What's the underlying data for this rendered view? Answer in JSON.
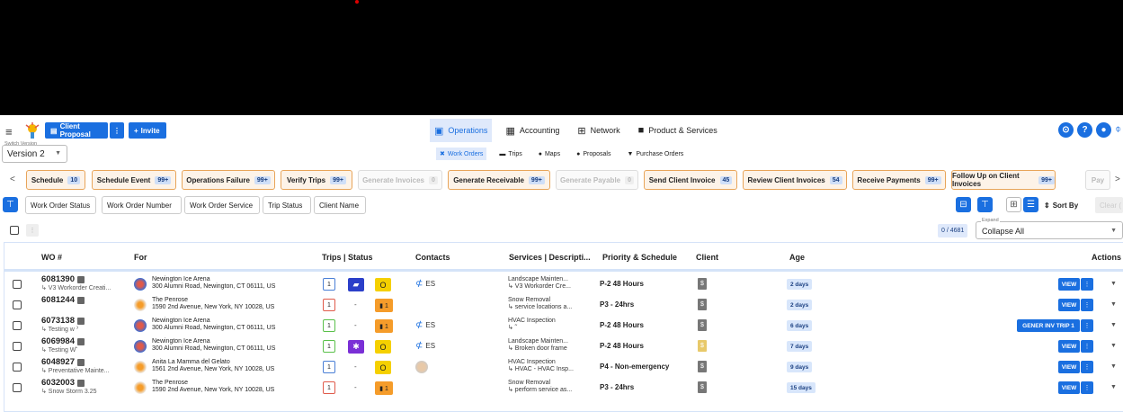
{
  "topbar": {
    "client_proposal": "Client Proposal",
    "more": "⋮",
    "invite": "Invite",
    "nav": [
      {
        "label": "Operations",
        "icon": "operations-icon",
        "glyph": "▣",
        "active": true
      },
      {
        "label": "Accounting",
        "icon": "accounting-icon",
        "glyph": "▦",
        "active": false
      },
      {
        "label": "Network",
        "icon": "network-icon",
        "glyph": "⊞",
        "active": false
      },
      {
        "label": "Product & Services",
        "icon": "briefcase-icon",
        "glyph": "■",
        "active": false
      }
    ]
  },
  "version": {
    "label": "Switch Version",
    "value": "Version 2"
  },
  "subnav": [
    {
      "label": "Work Orders",
      "icon": "work-orders-icon",
      "glyph": "✖",
      "active": true
    },
    {
      "label": "Trips",
      "icon": "car-icon",
      "glyph": "▬",
      "active": false
    },
    {
      "label": "Maps",
      "icon": "map-pin-icon",
      "glyph": "●",
      "active": false
    },
    {
      "label": "Proposals",
      "icon": "proposal-icon",
      "glyph": "●",
      "active": false
    },
    {
      "label": "Purchase Orders",
      "icon": "cart-icon",
      "glyph": "▼",
      "active": false
    }
  ],
  "chips": [
    {
      "label": "Schedule",
      "count": "10",
      "disabled": false
    },
    {
      "label": "Schedule Event",
      "count": "99+",
      "disabled": false
    },
    {
      "label": "Operations Failure",
      "count": "99+",
      "disabled": false
    },
    {
      "label": "Verify Trips",
      "count": "99+",
      "disabled": false
    },
    {
      "label": "Generate Invoices",
      "count": "0",
      "disabled": true
    },
    {
      "label": "Generate Receivable",
      "count": "99+",
      "disabled": false
    },
    {
      "label": "Generate Payable",
      "count": "0",
      "disabled": true
    },
    {
      "label": "Send Client Invoice",
      "count": "45",
      "disabled": false
    },
    {
      "label": "Review Client Invoices",
      "count": "54",
      "disabled": false
    },
    {
      "label": "Receive Payments",
      "count": "99+",
      "disabled": false
    },
    {
      "label": "Follow Up on Client Invoices",
      "count": "99+",
      "disabled": false
    },
    {
      "label": "Pay",
      "count": "",
      "disabled": true
    }
  ],
  "filters": [
    "Work Order Status",
    "Work Order Number",
    "Work Order Service",
    "Trip Status",
    "Client Name"
  ],
  "sort_by": "Sort By",
  "clear": "Clear (",
  "page_count": "0 / 4681",
  "expand": {
    "label": "Expand",
    "value": "Collapse All"
  },
  "columns": {
    "wo": "WO #",
    "for": "For",
    "trips": "Trips | Status",
    "contacts": "Contacts",
    "services": "Services | Descripti...",
    "priority": "Priority & Schedule",
    "client": "Client",
    "age": "Age",
    "actions": "Actions"
  },
  "rows": [
    {
      "wo": "6081390",
      "sub": "↳ V3 Workorder Creati...",
      "name": "Newington Ice Arena",
      "addr": "300 Alumni Road, Newington, CT 06111, US",
      "trips": "1",
      "trip_color": "#4a7fd6",
      "status": "truck",
      "status_glyph": "▰",
      "status_color": "#2b3fc9",
      "flag": "O",
      "flag_color": "#f5d000",
      "contact": "ES",
      "svc1": "Landscape Mainten...",
      "svc2": "↳ V3 Workorder Cre...",
      "priority": "P-2 48 Hours",
      "doc_color": "#777",
      "age": "2 days",
      "action": "VIEW"
    },
    {
      "wo": "6081244",
      "sub": "",
      "name": "The Penrose",
      "addr": "1590 2nd Avenue, New York, NY 10028, US",
      "trips": "1",
      "trip_color": "#e05a4a",
      "status": "",
      "status_glyph": "-",
      "status_color": "",
      "flag": "▮ 1",
      "flag_color": "#f59c2a",
      "contact": "",
      "svc1": "Snow Removal",
      "svc2": "↳ service locations a...",
      "priority": "P3 - 24hrs",
      "doc_color": "#777",
      "age": "2 days",
      "action": "VIEW"
    },
    {
      "wo": "6073138",
      "sub": "↳ Testing w ˀ",
      "name": "Newington Ice Arena",
      "addr": "300 Alumni Road, Newington, CT 06111, US",
      "trips": "1",
      "trip_color": "#5ac04a",
      "status": "",
      "status_glyph": "-",
      "status_color": "",
      "flag": "▮ 1",
      "flag_color": "#f59c2a",
      "contact": "ES",
      "svc1": "HVAC Inspection",
      "svc2": "↳ ˜",
      "priority": "P-2 48 Hours",
      "doc_color": "#777",
      "age": "6 days",
      "action": "GENER INV TRIP 1"
    },
    {
      "wo": "6069984",
      "sub": "↳ Testing W˞",
      "name": "Newington Ice Arena",
      "addr": "300 Alumni Road, Newington, CT 06111, US",
      "trips": "1",
      "trip_color": "#5ac04a",
      "status": "snow",
      "status_glyph": "✱",
      "status_color": "#7a2fd6",
      "flag": "O",
      "flag_color": "#f5d000",
      "contact": "ES",
      "svc1": "Landscape Mainten...",
      "svc2": "↳ Broken door frame",
      "priority": "P-2 48 Hours",
      "doc_color": "#e8c96a",
      "age": "7 days",
      "action": "VIEW"
    },
    {
      "wo": "6048927",
      "sub": "↳ Preventative Mainte...",
      "name": "Anita La Mamma del Gelato",
      "addr": "1561 2nd Avenue, New York, NY 10028, US",
      "trips": "1",
      "trip_color": "#4a7fd6",
      "status": "",
      "status_glyph": "-",
      "status_color": "",
      "flag": "O",
      "flag_color": "#f5d000",
      "contact": "avatar",
      "svc1": "HVAC Inspection",
      "svc2": "↳ HVAC - HVAC Insp...",
      "priority": "P4 - Non-emergency",
      "doc_color": "#777",
      "age": "9 days",
      "action": "VIEW"
    },
    {
      "wo": "6032003",
      "sub": "↳ Snow Storm 3.25",
      "name": "The Penrose",
      "addr": "1590 2nd Avenue, New York, NY 10028, US",
      "trips": "1",
      "trip_color": "#e05a4a",
      "status": "",
      "status_glyph": "-",
      "status_color": "",
      "flag": "▮ 1",
      "flag_color": "#f59c2a",
      "contact": "",
      "svc1": "Snow Removal",
      "svc2": "↳ perform service as...",
      "priority": "P3 - 24hrs",
      "doc_color": "#777",
      "age": "15 days",
      "action": "VIEW"
    }
  ]
}
